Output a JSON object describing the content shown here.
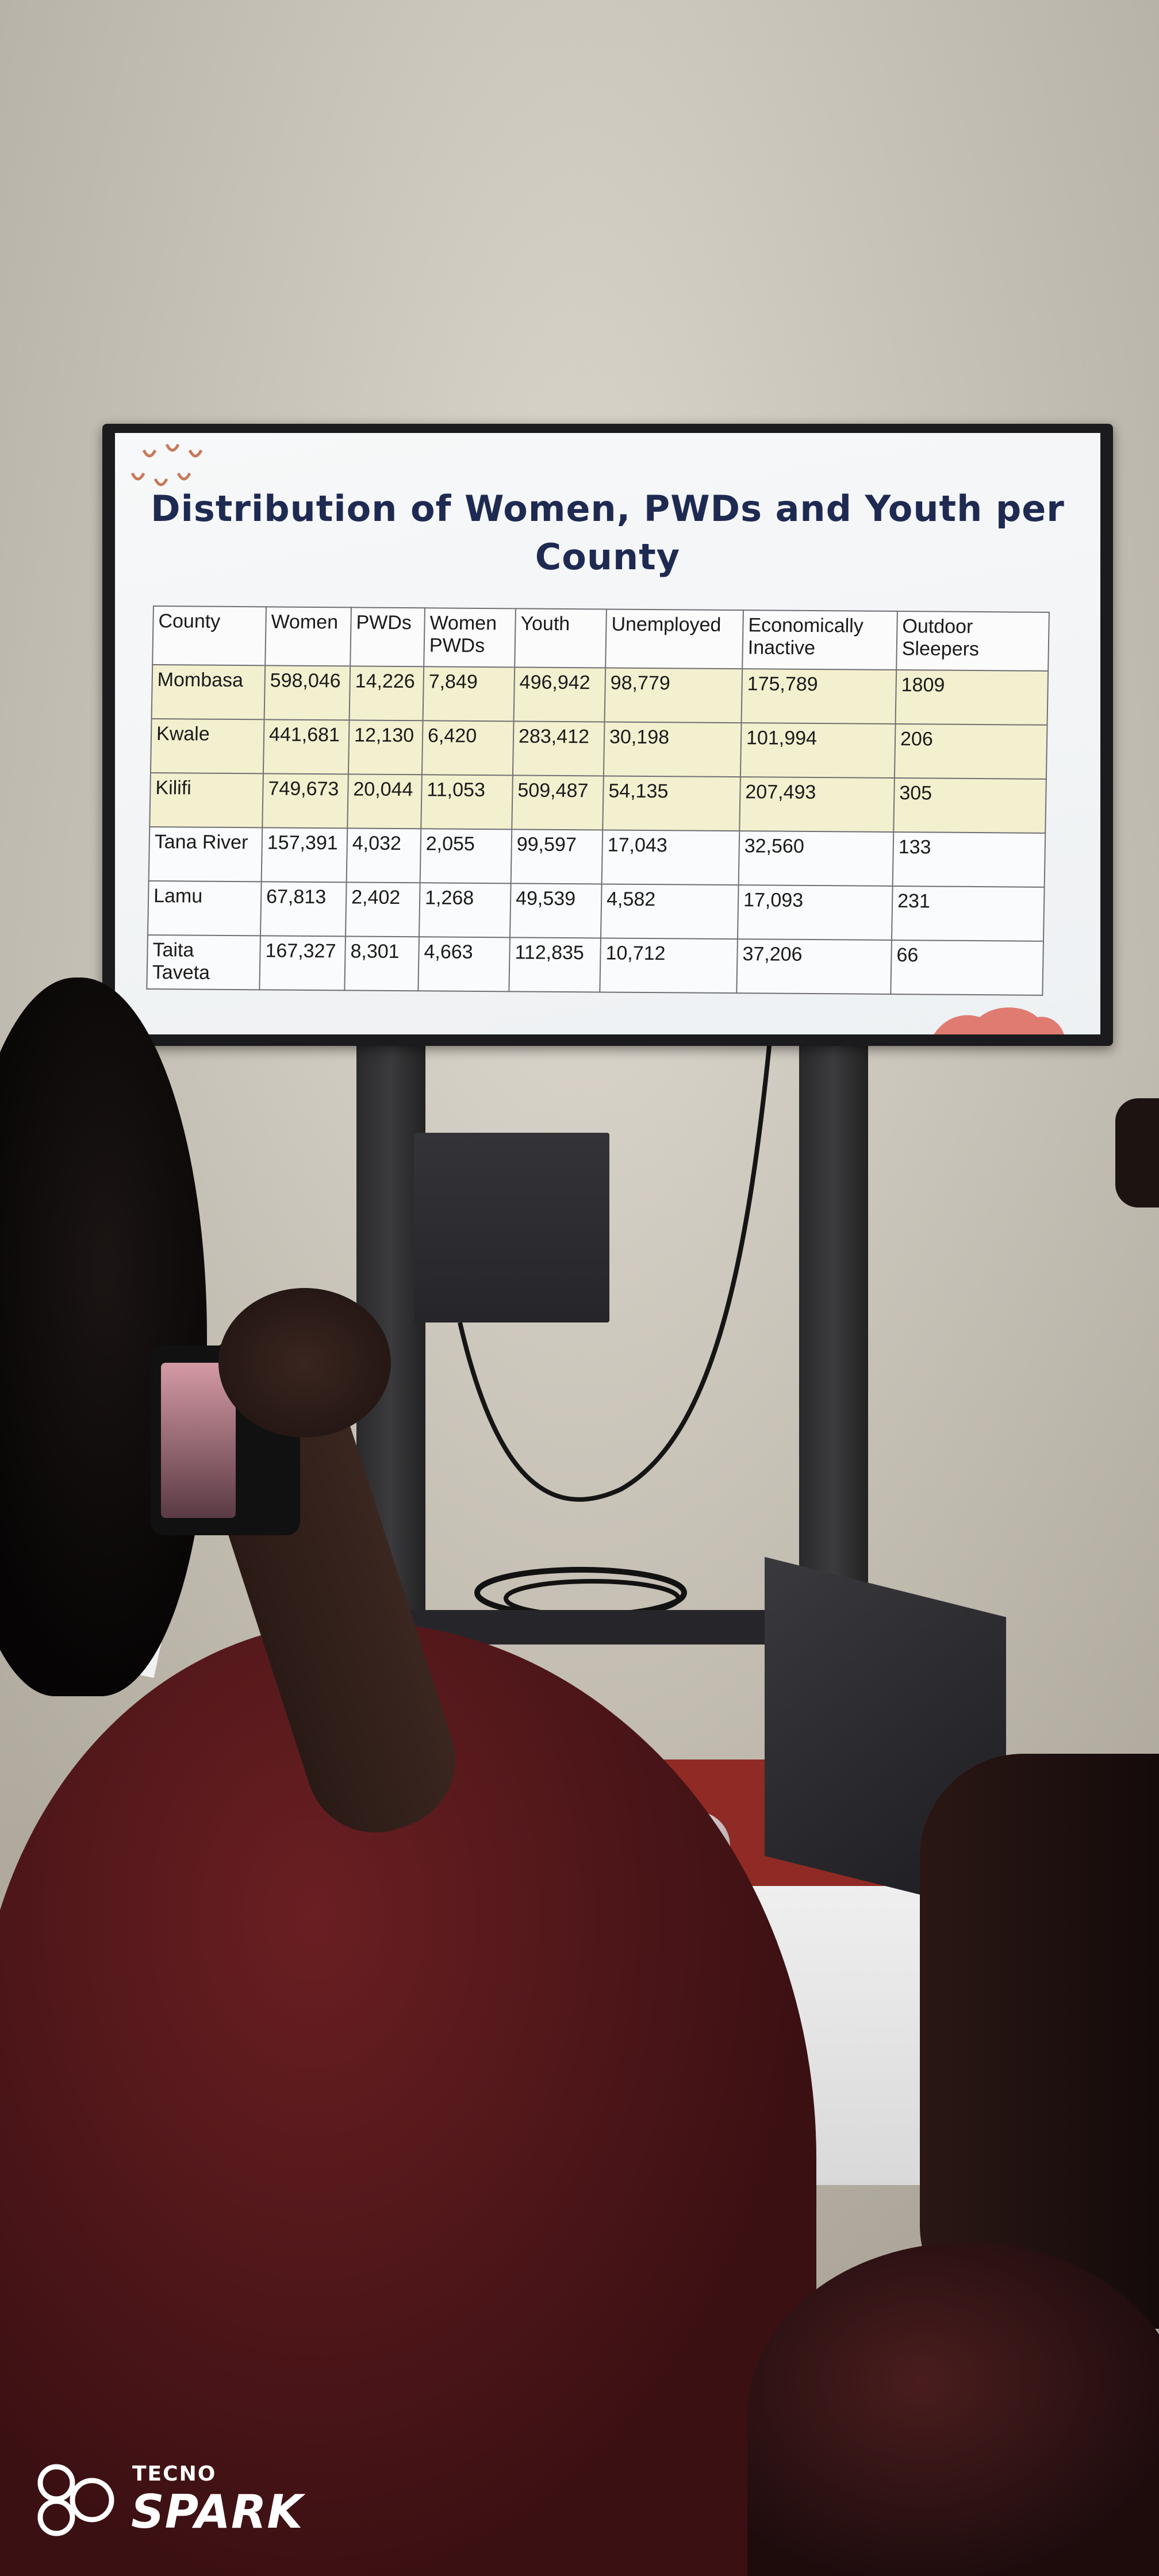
{
  "slide": {
    "title": "Distribution of Women, PWDs and Youth per County",
    "table": {
      "headers": [
        "County",
        "Women",
        "PWDs",
        "Women PWDs",
        "Youth",
        "Unemployed",
        "Economically Inactive",
        "Outdoor Sleepers"
      ],
      "rows": [
        [
          "Mombasa",
          "598,046",
          "14,226",
          "7,849",
          "496,942",
          "98,779",
          "175,789",
          "1809"
        ],
        [
          "Kwale",
          "441,681",
          "12,130",
          "6,420",
          "283,412",
          "30,198",
          "101,994",
          "206"
        ],
        [
          "Kilifi",
          "749,673",
          "20,044",
          "11,053",
          "509,487",
          "54,135",
          "207,493",
          "305"
        ],
        [
          "Tana River",
          "157,391",
          "4,032",
          "2,055",
          "99,597",
          "17,043",
          "32,560",
          "133"
        ],
        [
          "Lamu",
          "67,813",
          "2,402",
          "1,268",
          "49,539",
          "4,582",
          "17,093",
          "231"
        ],
        [
          "Taita Taveta",
          "167,327",
          "8,301",
          "4,663",
          "112,835",
          "10,712",
          "37,206",
          "66"
        ]
      ]
    },
    "highlight_color": "#f3f0cf",
    "title_color": "#1f2a52"
  },
  "watermark": {
    "brand": "TECNO",
    "model": "SPARK"
  }
}
